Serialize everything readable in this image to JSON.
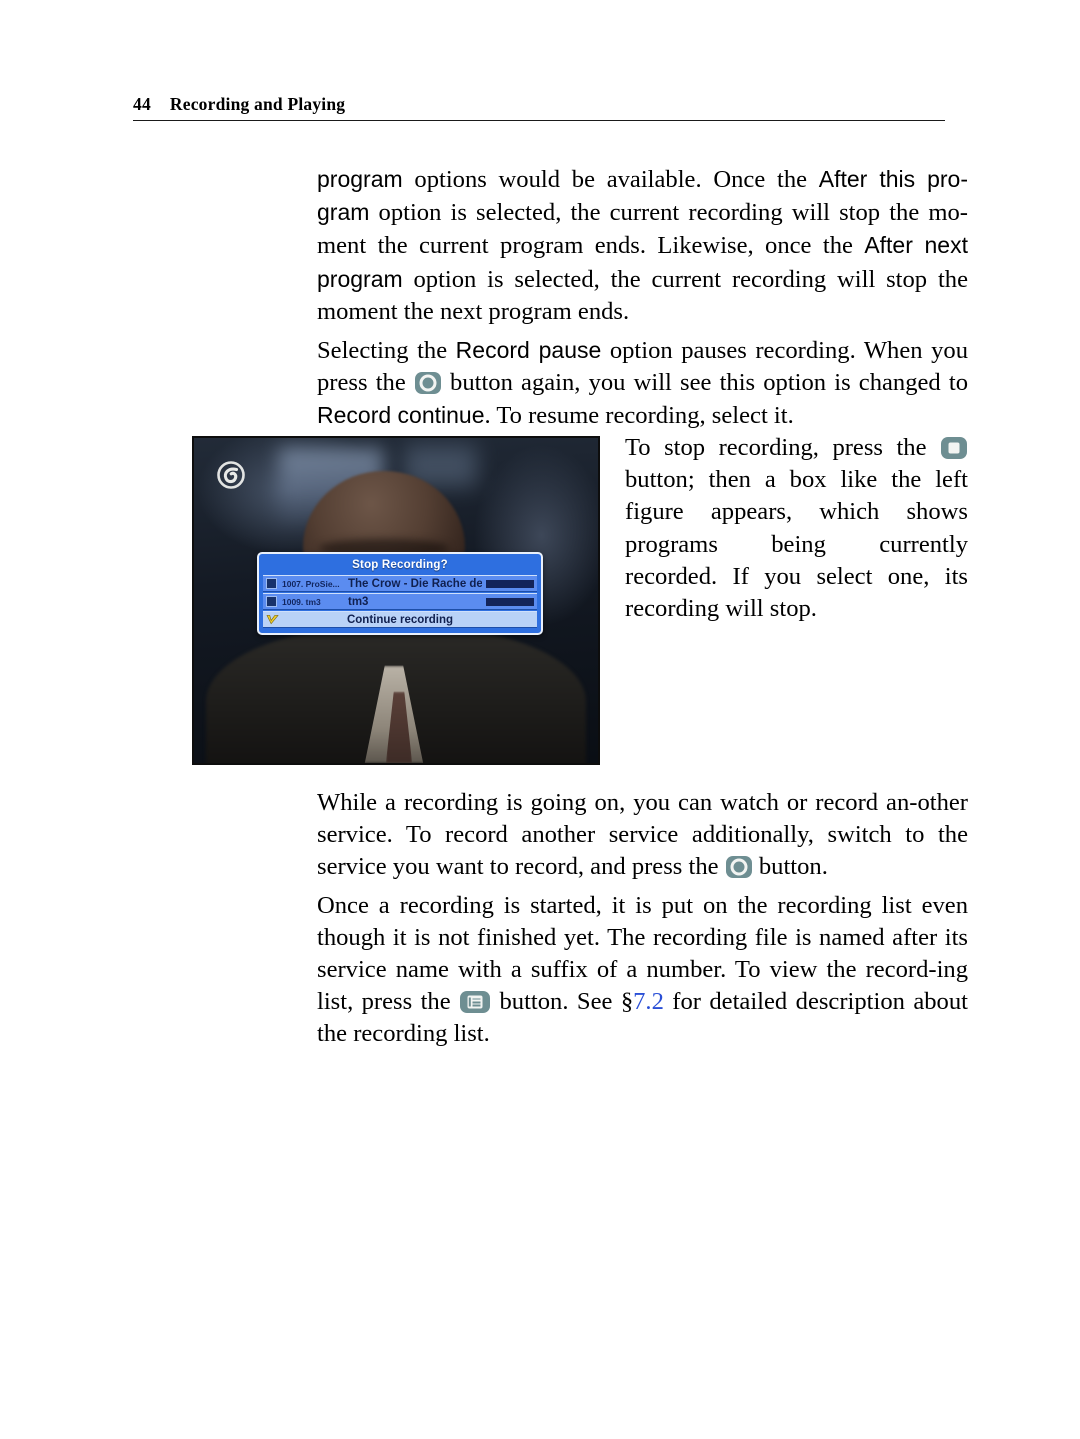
{
  "header": {
    "page_number": "44",
    "title": "Recording and Playing"
  },
  "body": {
    "para1_a": "program",
    "para1_b": " options would be available. Once the ",
    "para1_c": "After this pro-gram",
    "para1_d": " option is selected, the current recording will stop the mo-ment the current program ends. Likewise, once the ",
    "para1_e": "After next program",
    "para1_f": " option is selected, the current recording will stop the moment the next program ends.",
    "para2_a": "Selecting the ",
    "para2_b": "Record pause",
    "para2_c": " option pauses recording. When you press the ",
    "para2_d": " button again, you will see this option is changed to ",
    "para2_e": "Record continue",
    "para2_f": ". To resume recording, select it.",
    "para3_a": "To stop recording, press the ",
    "para3_b": " button; then a box like the left figure appears, which shows programs being currently recorded. If you select one, its recording will stop.",
    "para4_a": "While a recording is going on, you can watch or record an-other service. To record another service additionally, switch to the service you want to record, and press the ",
    "para4_b": " button.",
    "para5_a": "Once a recording is started, it is put on the recording list even though it is not finished yet. The recording file is named after its service name with a suffix of a number. To view the record-ing list, press the ",
    "para5_b": " button. See §",
    "para5_link": "7.2",
    "para5_c": " for detailed description about the recording list."
  },
  "figure": {
    "caption": "",
    "osd": {
      "title": "Stop Recording?",
      "rows": [
        {
          "service": "1007. ProSie...",
          "program": "The Crow - Die Rache de.."
        },
        {
          "service": "1009. tm3",
          "program": "tm3"
        }
      ],
      "continue_label": "Continue recording"
    }
  },
  "colors": {
    "key_button": "#6e8e92",
    "key_glyph": "#f2f4f2",
    "osd_background": "#2e6fe0",
    "osd_row": "#5b8cf0",
    "osd_selected_row": "#b9d2f7",
    "osd_title_text": "#ffffff",
    "osd_body_text": "#10204f",
    "osd_bar": "#13245a",
    "link": "#2a4fd6",
    "checkmark": "#f2d02c",
    "rule": "#1a1a1a"
  }
}
